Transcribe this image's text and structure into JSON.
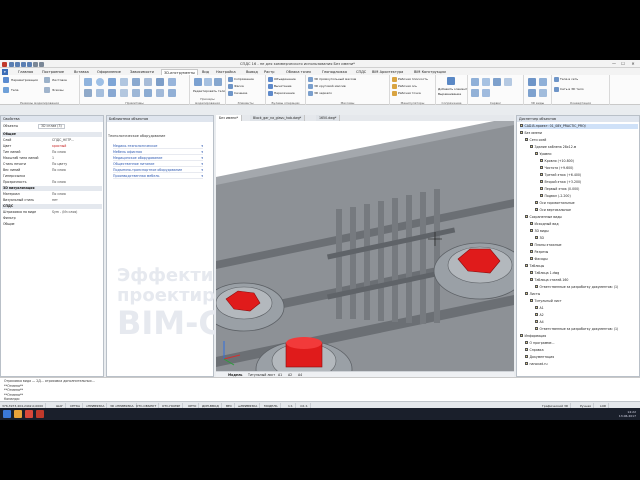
{
  "window": {
    "title": "СПДС 16 - не для коммерческого использования Без имени*",
    "controls": [
      "—",
      "☐",
      "✕"
    ]
  },
  "ribbon_tabs": [
    "Главная",
    "Построение",
    "Вставка",
    "Оформление",
    "Зависимости",
    "3D-инструменты",
    "Вид",
    "Настройка",
    "Вывод",
    "Растр",
    "Облака точек",
    "Геоподложка",
    "СПДС",
    "BIM Архитектура",
    "BIM Конструкции"
  ],
  "active_ribbon_tab": 5,
  "ribbon_groups": [
    {
      "label": "Режимы моделирования",
      "items": [
        "Параметризация",
        "Листовое",
        "Тела",
        "Эскизы"
      ]
    },
    {
      "label": "Примитивы",
      "items": []
    },
    {
      "label": "Примеры моделирования",
      "items": [
        "Редактировать тело"
      ]
    },
    {
      "label": "Элементы",
      "items": [
        "Сопряжение",
        "Фаска",
        "Сечение"
      ]
    },
    {
      "label": "Булевы операции",
      "items": [
        "Объединение",
        "Вычитание",
        "Пересечение"
      ]
    },
    {
      "label": "Массивы",
      "items": [
        "3D прямоугольный массив",
        "3D круговой массив",
        "3D зеркало"
      ]
    },
    {
      "label": "Манипуляторы",
      "items": [
        "Рабочая плоскость",
        "Рабочая ось",
        "Рабочая точка"
      ]
    },
    {
      "label": "Сопряжение",
      "items": [
        "Добавить элемент",
        "Выравнивание"
      ]
    },
    {
      "label": "Сервис",
      "items": []
    },
    {
      "label": "3D виды",
      "items": []
    },
    {
      "label": "Конвертация",
      "items": [
        "Тела в сеть",
        "Сеть в 3D тело"
      ]
    }
  ],
  "properties_panel": {
    "title": "Свойства",
    "object_label": "Объекты",
    "object_value": "3D сплав (3)",
    "rows": [
      {
        "k": "Общие",
        "v": "",
        "section": true
      },
      {
        "k": "Слой",
        "v": "СПДС_НЕТР..."
      },
      {
        "k": "Цвет",
        "v": "красный"
      },
      {
        "k": "Тип линий",
        "v": "По слою"
      },
      {
        "k": "Масштаб типа линий",
        "v": "1"
      },
      {
        "k": "Стиль печати",
        "v": "По цвету"
      },
      {
        "k": "Вес линий",
        "v": "По слою"
      },
      {
        "k": "Гиперссылка",
        "v": ""
      },
      {
        "k": "Прозрачность",
        "v": "По слою"
      },
      {
        "k": "3D визуализация",
        "v": "",
        "section": true
      },
      {
        "k": "Материал",
        "v": "По слою"
      },
      {
        "k": "Визуальный стиль",
        "v": "нет"
      },
      {
        "k": "СПДС",
        "v": "",
        "section": true
      },
      {
        "k": "Штриховка на виде",
        "v": "Sym - (Из слоя)"
      },
      {
        "k": "Фильтр",
        "v": ""
      },
      {
        "k": "Общие",
        "v": ""
      }
    ]
  },
  "catalog_panel": {
    "title": "Библиотека объектов",
    "subtitle": "Технологическое оборудование",
    "items": [
      "Медико-технологическое",
      "Мебель офисная",
      "Медицинское оборудование",
      "Общественное питание",
      "Подъемно-транспортное оборудование",
      "Производственная мебель"
    ],
    "watermark": [
      "Эффективные решения",
      "проектирования",
      "BIM-CAD"
    ]
  },
  "viewport_tabs": [
    "Без имени*",
    "Block_gar_na_glavu_hob.dwg*",
    "1650.dwg*"
  ],
  "active_viewport_tab": 0,
  "bottom_tabs": [
    "Модель",
    "Титульный лист",
    "А1",
    "А2",
    "А4"
  ],
  "doc_manager": {
    "title": "Диспетчер объектов",
    "selected": "CAD-B-проект: 01_08У_PRACTIC_PROJ",
    "nodes": [
      {
        "label": "CAD-B-проект: 01_08У_PRACTIC_PROJ",
        "lvl": 0,
        "sel": true
      },
      {
        "label": "Без имени",
        "lvl": 0
      },
      {
        "label": "Сети осей",
        "lvl": 1
      },
      {
        "label": "Здание каблена 28х12.м",
        "lvl": 2
      },
      {
        "label": "Уровни",
        "lvl": 3
      },
      {
        "label": "Кровля (+10.800)",
        "lvl": 4
      },
      {
        "label": "Чистота (+9.600)",
        "lvl": 4
      },
      {
        "label": "Третий этаж (+6.400)",
        "lvl": 4
      },
      {
        "label": "Второй этаж (+3.200)",
        "lvl": 4
      },
      {
        "label": "Первый этаж (0.000)",
        "lvl": 4
      },
      {
        "label": "Подвал (-2.200)",
        "lvl": 4
      },
      {
        "label": "Оси горизонтальные",
        "lvl": 3
      },
      {
        "label": "Оси вертикальные",
        "lvl": 3
      },
      {
        "label": "Сохраненные виды",
        "lvl": 1
      },
      {
        "label": "Исходный вид",
        "lvl": 2
      },
      {
        "label": "3D виды",
        "lvl": 2
      },
      {
        "label": "3D",
        "lvl": 3
      },
      {
        "label": "Планы этажные",
        "lvl": 2
      },
      {
        "label": "Разрезы",
        "lvl": 2
      },
      {
        "label": "Фасады",
        "lvl": 2
      },
      {
        "label": "Таблицы",
        "lvl": 1
      },
      {
        "label": "Таблица 1.dwg",
        "lvl": 2
      },
      {
        "label": "Таблица стилей.160",
        "lvl": 2
      },
      {
        "label": "Ответственные за разработку документов: (1)",
        "lvl": 3
      },
      {
        "label": "Листы",
        "lvl": 1
      },
      {
        "label": "Титульный лист",
        "lvl": 2
      },
      {
        "label": "А1",
        "lvl": 3
      },
      {
        "label": "А2",
        "lvl": 3
      },
      {
        "label": "А4",
        "lvl": 3
      },
      {
        "label": "Ответственные за разработку документов: (1)",
        "lvl": 3
      },
      {
        "label": "Информация",
        "lvl": 0
      },
      {
        "label": "О программе...",
        "lvl": 1
      },
      {
        "label": "Справка",
        "lvl": 1
      },
      {
        "label": "Документация",
        "lvl": 1
      },
      {
        "label": "nanocad.ru",
        "lvl": 1
      }
    ]
  },
  "command_line": [
    "Отрисовка вида — 2Д... отрисовка дополнительных...",
    "**Отмена**",
    "**Отмена**",
    "**Отмена**",
    "Команда:"
  ],
  "statusbar": [
    "376,3973,404,2442,0,0000",
    "ШАГ",
    "СЕТКА",
    "оПРИВЯЗКА",
    "3D оПРИВЯЗКА",
    "ОТС-ОБЪЕКТ",
    "ОТС-ПОЛЯР",
    "ОРТО",
    "ДИН-ВВОД",
    "ВЕС",
    "шПРИВЯЗКА",
    "МОДЕЛЬ",
    "1:1",
    "m1:1"
  ],
  "statusbar_right": [
    "Графический 3D",
    "Ручная",
    "LOD"
  ],
  "clock": {
    "time": "14:22",
    "date": "13.06.2017"
  }
}
